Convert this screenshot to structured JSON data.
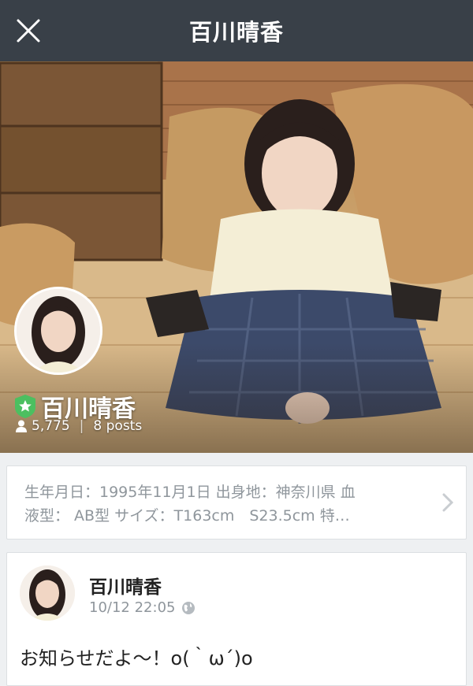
{
  "header": {
    "title": "百川晴香"
  },
  "profile": {
    "name": "百川晴香",
    "followers": "5,775",
    "separator": "|",
    "posts": "8 posts"
  },
  "bio": {
    "text_line1": "生年月日：1995年11月1日 出身地：神奈川県 血",
    "text_line2": "液型： AB型 サイズ：T163cm　S23.5cm 特…"
  },
  "post": {
    "author": "百川晴香",
    "time": "10/12 22:05",
    "body_line1": "お知らせだよ〜！o(｀ω´)o"
  },
  "colors": {
    "header_bg": "#394048",
    "badge_green": "#4cbf60"
  }
}
